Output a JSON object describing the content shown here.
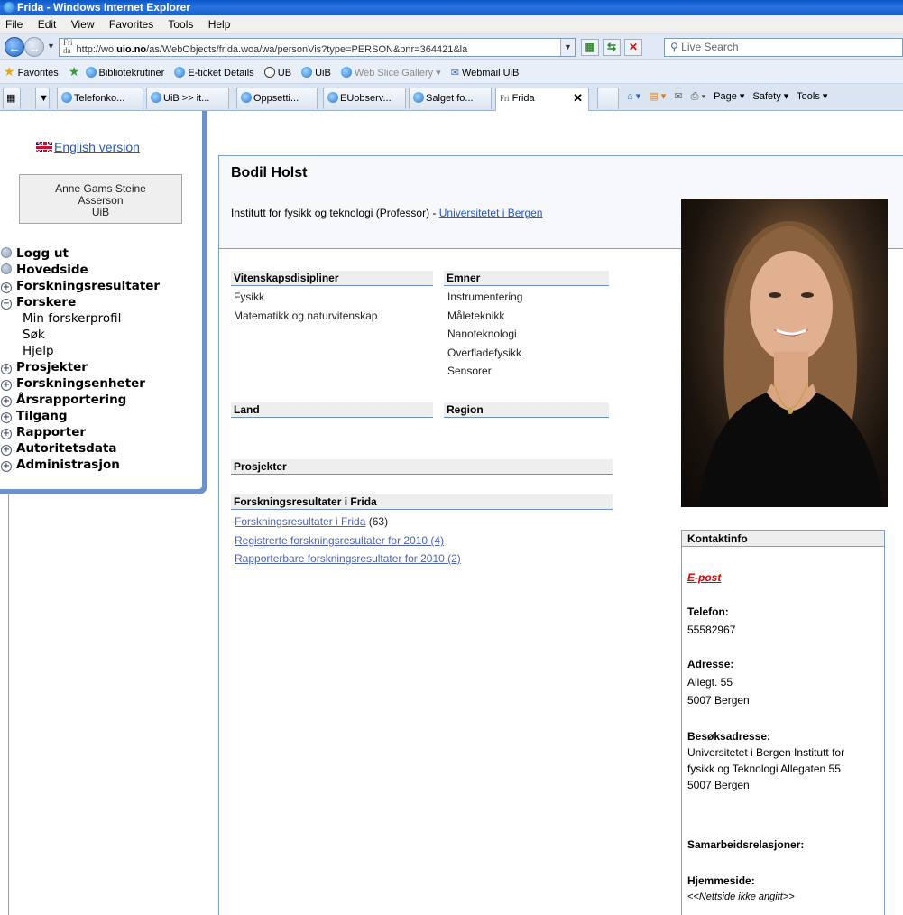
{
  "window": {
    "title": "Frida - Windows Internet Explorer"
  },
  "menubar": [
    "File",
    "Edit",
    "View",
    "Favorites",
    "Tools",
    "Help"
  ],
  "address": {
    "url_prefix": "http://wo.",
    "url_bold": "uio.no",
    "url_rest": "/as/WebObjects/frida.woa/wa/personVis?type=PERSON&pnr=364421&la",
    "search_placeholder": "Live Search"
  },
  "favorites_bar": {
    "favorites_label": "Favorites",
    "items": [
      "Bibliotekrutiner",
      "E-ticket Details",
      "UB",
      "UiB",
      "Web Slice Gallery ▾",
      "Webmail UiB"
    ]
  },
  "tabs": [
    {
      "label": "Telefonko..."
    },
    {
      "label": "UiB >> it..."
    },
    {
      "label": "Oppsetti..."
    },
    {
      "label": "EUobserv..."
    },
    {
      "label": "Salget fo..."
    },
    {
      "label": "Frida",
      "active": true
    }
  ],
  "command_bar": [
    "Page ▾",
    "Safety ▾",
    "Tools ▾"
  ],
  "sidebar": {
    "english_link": "English version",
    "user": {
      "line1": "Anne Gams Steine",
      "line2": "Asserson",
      "line3": "UiB"
    },
    "menu": [
      {
        "label": "Logg ut",
        "type": "bullet"
      },
      {
        "label": "Hovedside",
        "type": "bullet"
      },
      {
        "label": "Forskningsresultater",
        "type": "plus"
      },
      {
        "label": "Forskere",
        "type": "minus"
      },
      {
        "label": "Min forskerprofil",
        "type": "sub"
      },
      {
        "label": "Søk",
        "type": "sub"
      },
      {
        "label": "Hjelp",
        "type": "sub"
      },
      {
        "label": "Prosjekter",
        "type": "plus"
      },
      {
        "label": "Forskningsenheter",
        "type": "plus"
      },
      {
        "label": "Årsrapportering",
        "type": "plus"
      },
      {
        "label": "Tilgang",
        "type": "plus"
      },
      {
        "label": "Rapporter",
        "type": "plus"
      },
      {
        "label": "Autoritetsdata",
        "type": "plus"
      },
      {
        "label": "Administrasjon",
        "type": "plus"
      }
    ]
  },
  "profile": {
    "name": "Bodil Holst",
    "affiliation_text": "Institutt for fysikk og teknologi (Professor) - ",
    "affiliation_link": "Universitetet i Bergen",
    "disciplines_header": "Vitenskapsdisipliner",
    "disciplines": [
      "Fysikk",
      "Matematikk og naturvitenskap"
    ],
    "topics_header": "Emner",
    "topics": [
      "Instrumentering",
      "Måleteknikk",
      "Nanoteknologi",
      "Overfladefysikk",
      "Sensorer"
    ],
    "land_header": "Land",
    "region_header": "Region",
    "projects_header": "Prosjekter",
    "results_header": "Forskningsresultater i Frida",
    "results_link": "Forskningsresultater i Frida",
    "results_count": "(63)",
    "registered_link": "Registrerte forskningsresultater for  2010 (4)",
    "reportable_link": "Rapporterbare forskningsresultater for  2010 (2)"
  },
  "contact": {
    "header": "Kontaktinfo",
    "email_link": "E-post",
    "phone_label": "Telefon:",
    "phone": "55582967",
    "address_label": "Adresse:",
    "address_line1": "Allegt. 55",
    "address_line2": "5007 Bergen",
    "visit_label": "Besøksadresse:",
    "visit_line1": "Universitetet i Bergen Institutt for",
    "visit_line2": "fysikk og Teknologi Allegaten 55",
    "visit_line3": "5007 Bergen",
    "collab_label": "Samarbeidsrelasjoner:",
    "homepage_label": "Hjemmeside:",
    "homepage_value": "<<Nettside ikke angitt>>"
  }
}
